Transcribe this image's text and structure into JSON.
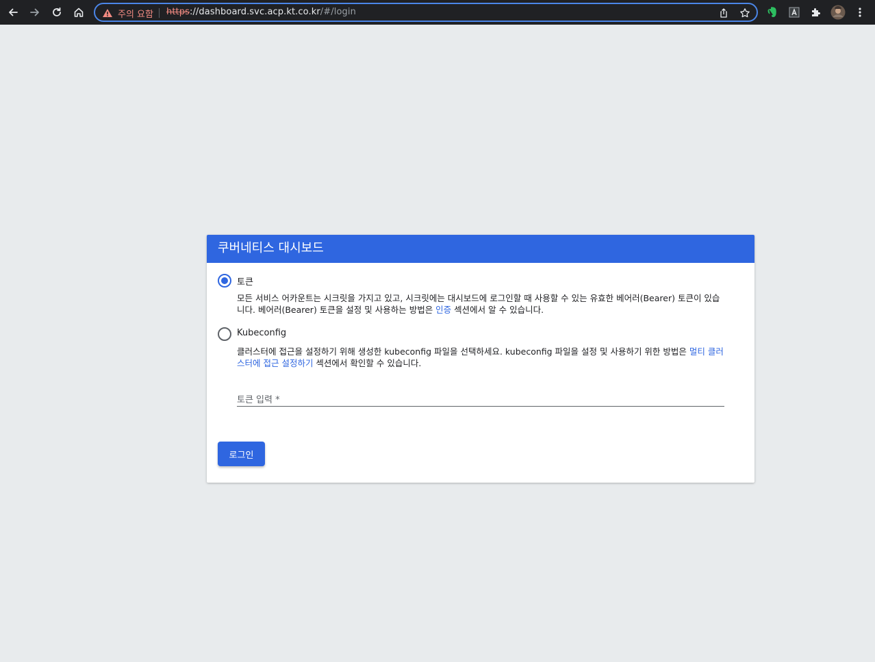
{
  "browser": {
    "security_warning": "주의 요함",
    "url_scheme": "https",
    "url_host": "://dashboard.svc.acp.kt.co.kr",
    "url_path": "/#/login"
  },
  "login": {
    "title": "쿠버네티스 대시보드",
    "options": [
      {
        "label": "토큰",
        "selected": true,
        "description_before": "모든 서비스 어카운트는 시크릿을 가지고 있고, 시크릿에는 대시보드에 로그인할 때 사용할 수 있는 유효한 베어러(Bearer) 토큰이 있습니다. 베어러(Bearer) 토큰을 설정 및 사용하는 방법은 ",
        "description_link": "인증",
        "description_after": " 섹션에서 알 수 있습니다."
      },
      {
        "label": "Kubeconfig",
        "selected": false,
        "description_before": "클러스터에 접근을 설정하기 위해 생성한 kubeconfig 파일을 선택하세요. kubeconfig 파일을 설정 및 사용하기 위한 방법은 ",
        "description_link": "멀티 클러스터에 접근 설정하기",
        "description_after": " 섹션에서 확인할 수 있습니다."
      }
    ],
    "token_placeholder": "토큰 입력 *",
    "login_button": "로그인"
  },
  "colors": {
    "primary": "#2f66e0",
    "background": "#e8ebed",
    "toolbar": "#202124"
  }
}
